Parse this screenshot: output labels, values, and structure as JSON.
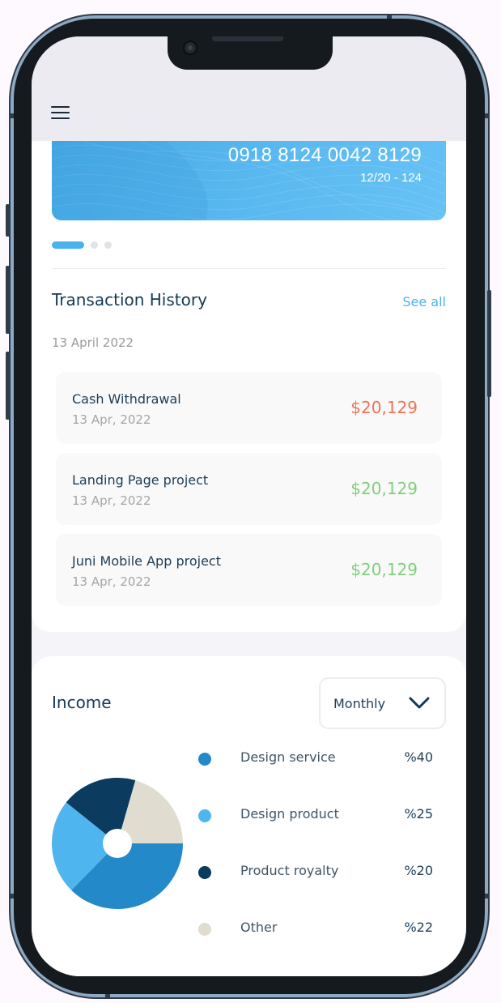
{
  "header": {
    "menu_icon": "hamburger-menu-icon"
  },
  "card": {
    "number": "0918 8124 0042 8129",
    "expiry": "12/20 - 124",
    "color": "#4ab2ee"
  },
  "carousel": {
    "page_count": 3,
    "active_index": 0
  },
  "transactions": {
    "title": "Transaction History",
    "see_all": "See all",
    "date_heading": "13 April 2022",
    "items": [
      {
        "name": "Cash Withdrawal",
        "date": "13 Apr, 2022",
        "amount": "$20,129",
        "color": "#ee7358"
      },
      {
        "name": "Landing Page project",
        "date": "13 Apr, 2022",
        "amount": "$20,129",
        "color": "#7fcf7a"
      },
      {
        "name": "Juni Mobile App project",
        "date": "13 Apr, 2022",
        "amount": "$20,129",
        "color": "#7fcf7a"
      }
    ]
  },
  "income": {
    "title": "Income",
    "period": "Monthly",
    "dropdown_icon": "chevron-down-icon",
    "legend": [
      {
        "label": "Design service",
        "value": "%40",
        "color": "#2489c9"
      },
      {
        "label": "Design product",
        "value": "%25",
        "color": "#4eb5ee"
      },
      {
        "label": "Product royalty",
        "value": "%20",
        "color": "#0b3b5e"
      },
      {
        "label": "Other",
        "value": "%22",
        "color": "#e0ddd0"
      }
    ]
  },
  "chart_data": {
    "type": "pie",
    "categories": [
      "Design service",
      "Design product",
      "Product royalty",
      "Other"
    ],
    "values": [
      40,
      25,
      20,
      22
    ],
    "colors": [
      "#2489c9",
      "#4eb5ee",
      "#0b3b5e",
      "#e0ddd0"
    ],
    "donut_hole": true
  }
}
